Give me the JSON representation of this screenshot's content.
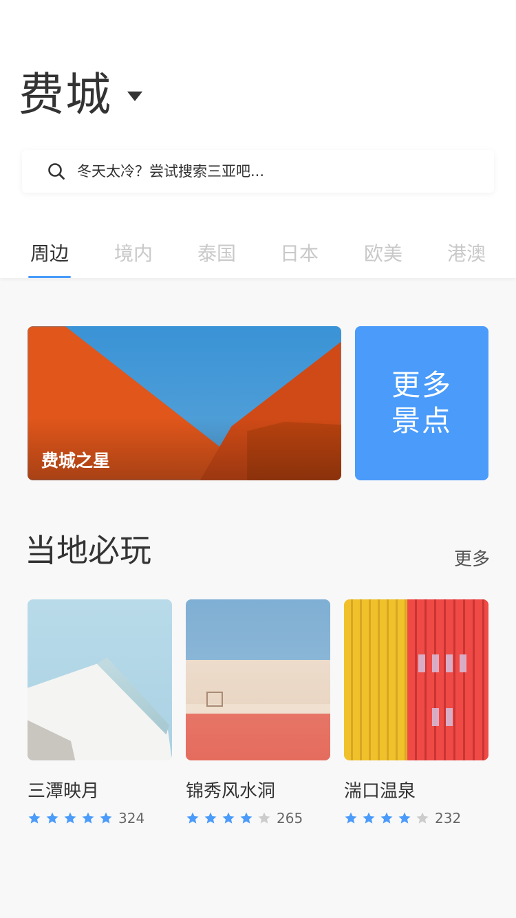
{
  "header": {
    "city": "费城",
    "search_placeholder": "冬天太冷？尝试搜索三亚吧..."
  },
  "tabs": [
    {
      "label": "周边",
      "active": true
    },
    {
      "label": "境内",
      "active": false
    },
    {
      "label": "泰国",
      "active": false
    },
    {
      "label": "日本",
      "active": false
    },
    {
      "label": "欧美",
      "active": false
    },
    {
      "label": "港澳",
      "active": false
    }
  ],
  "featured": {
    "title": "费城之星",
    "more_line1": "更多",
    "more_line2": "景点"
  },
  "section": {
    "title": "当地必玩",
    "more": "更多"
  },
  "cards": [
    {
      "name": "三潭映月",
      "stars": 5,
      "count": "324"
    },
    {
      "name": "锦秀风水洞",
      "stars": 4,
      "count": "265"
    },
    {
      "name": "湍口温泉",
      "stars": 4,
      "count": "232"
    }
  ],
  "colors": {
    "accent": "#4a9bfa",
    "star_on": "#4a9bfa",
    "star_off": "#cccccc"
  }
}
